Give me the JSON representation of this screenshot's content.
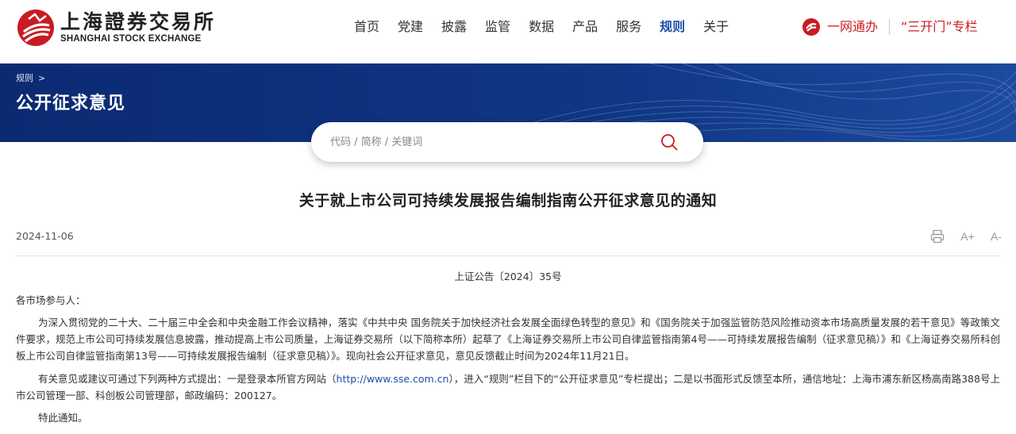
{
  "header": {
    "logo_cn": "上海證券交易所",
    "logo_en": "SHANGHAI STOCK EXCHANGE",
    "nav": [
      "首页",
      "党建",
      "披露",
      "监管",
      "数据",
      "产品",
      "服务",
      "规则",
      "关于"
    ],
    "active_nav": "规则",
    "ywtb_label": "一网通办",
    "skm_label": "“三开门”专栏"
  },
  "banner": {
    "breadcrumb": "规则",
    "breadcrumb_sep": ">",
    "title": "公开征求意见"
  },
  "search": {
    "placeholder": "代码 / 简称 / 关键词",
    "value": ""
  },
  "article": {
    "title": "关于就上市公司可持续发展报告编制指南公开征求意见的通知",
    "date": "2024-11-06",
    "tools": {
      "font_larger": "A+",
      "font_smaller": "A-"
    },
    "announcement_no": "上证公告〔2024〕35号",
    "salutation": "各市场参与人：",
    "para1": "为深入贯彻党的二十大、二十届三中全会和中央金融工作会议精神，落实《中共中央 国务院关于加快经济社会发展全面绿色转型的意见》和《国务院关于加强监管防范风险推动资本市场高质量发展的若干意见》等政策文件要求，规范上市公司可持续发展信息披露，推动提高上市公司质量，上海证券交易所（以下简称本所）起草了《上海证券交易所上市公司自律监管指南第4号——可持续发展报告编制（征求意见稿）》和《上海证券交易所科创板上市公司自律监管指南第13号——可持续发展报告编制（征求意见稿）》。现向社会公开征求意见，意见反馈截止时间为2024年11月21日。",
    "para2_before": "有关意见或建议可通过下列两种方式提出：一是登录本所官方网站（",
    "para2_link": "http://www.sse.com.cn",
    "para2_after": "），进入“规则”栏目下的“公开征求意见”专栏提出；二是以书面形式反馈至本所，通信地址：上海市浦东新区杨高南路388号上市公司管理一部、科创板公司管理部，邮政编码：200127。",
    "para3": "特此通知。"
  },
  "colors": {
    "brand_red": "#c81b23",
    "nav_active": "#1c4fa8",
    "banner_bg": "#0e2f7c",
    "link": "#1c4fa8"
  }
}
